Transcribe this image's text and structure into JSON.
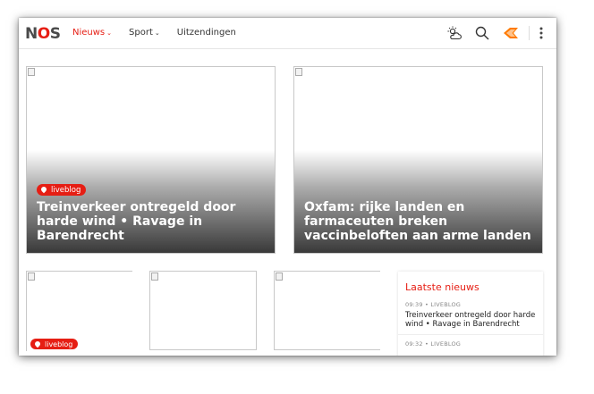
{
  "logo": "NOS",
  "nav": {
    "items": [
      {
        "label": "Nieuws",
        "has_dropdown": true,
        "active": true
      },
      {
        "label": "Sport",
        "has_dropdown": true,
        "active": false
      },
      {
        "label": "Uitzendingen",
        "has_dropdown": false,
        "active": false
      }
    ]
  },
  "icons": [
    "weather-icon",
    "search-icon",
    "npo-start-icon",
    "more-vertical-icon"
  ],
  "colors": {
    "accent": "#e61e14",
    "text": "#333333"
  },
  "featured": [
    {
      "badge": "liveblog",
      "title": "Treinverkeer ontregeld door harde wind • Ravage in Barendrecht"
    },
    {
      "badge": "",
      "title": "Oxfam: rijke landen en farmaceuten breken vaccinbeloften aan arme landen"
    }
  ],
  "tiles": [
    {
      "badge": "liveblog"
    },
    {
      "badge": ""
    },
    {
      "badge": ""
    }
  ],
  "latest_news": {
    "heading": "Laatste nieuws",
    "items": [
      {
        "time": "09:39",
        "category": "LIVEBLOG",
        "headline": "Treinverkeer ontregeld door harde wind • Ravage in Barendrecht"
      },
      {
        "time": "09:32",
        "category": "LIVEBLOG",
        "headline": ""
      }
    ]
  }
}
